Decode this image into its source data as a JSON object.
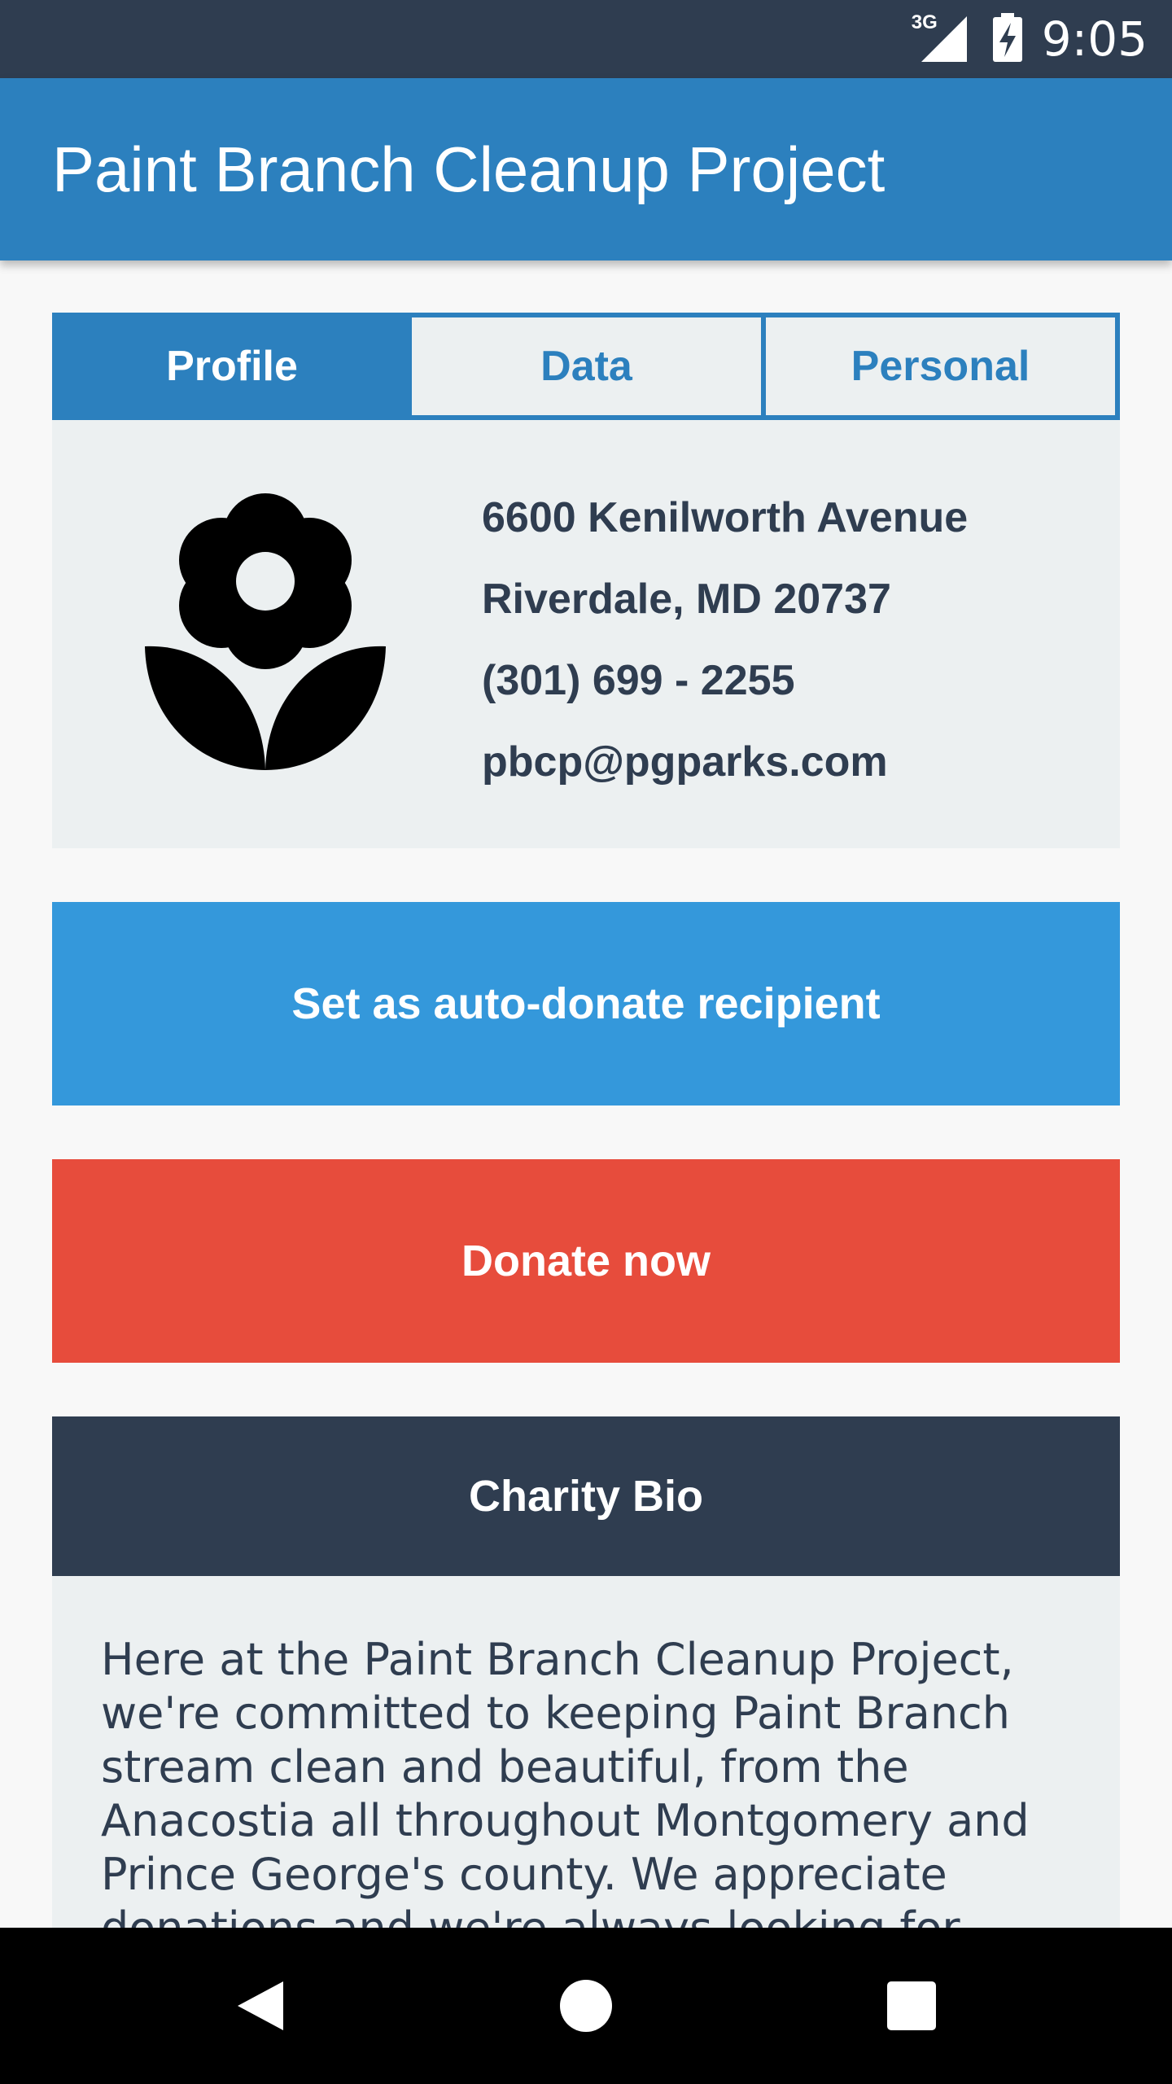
{
  "status_bar": {
    "network": "3G",
    "time": "9:05"
  },
  "app_bar": {
    "title": "Paint Branch Cleanup Project"
  },
  "tabs": [
    {
      "label": "Profile",
      "active": true
    },
    {
      "label": "Data",
      "active": false
    },
    {
      "label": "Personal",
      "active": false
    }
  ],
  "profile": {
    "logo_icon": "flower-icon",
    "address_line1": "6600 Kenilworth Avenue",
    "address_line2": "Riverdale, MD 20737",
    "phone": "(301) 699 - 2255",
    "email": "pbcp@pgparks.com"
  },
  "buttons": {
    "auto_donate": "Set as auto-donate recipient",
    "donate_now": "Donate now"
  },
  "bio": {
    "title": "Charity Bio",
    "text": "Here at the Paint Branch Cleanup Project, we're committed to keeping Paint Branch stream clean and beautiful, from the Anacostia all throughout Montgomery and Prince George's county. We appreciate donations and we're always looking for more volunteers, so feel free"
  },
  "nav_bar": {
    "icons": [
      "back-icon",
      "home-icon",
      "recents-icon"
    ]
  },
  "colors": {
    "primary": "#2c80be",
    "dark": "#2f3d50",
    "light": "#ecf0f1",
    "auto_donate_button": "#3498db",
    "donate_button": "#e74c3c"
  }
}
